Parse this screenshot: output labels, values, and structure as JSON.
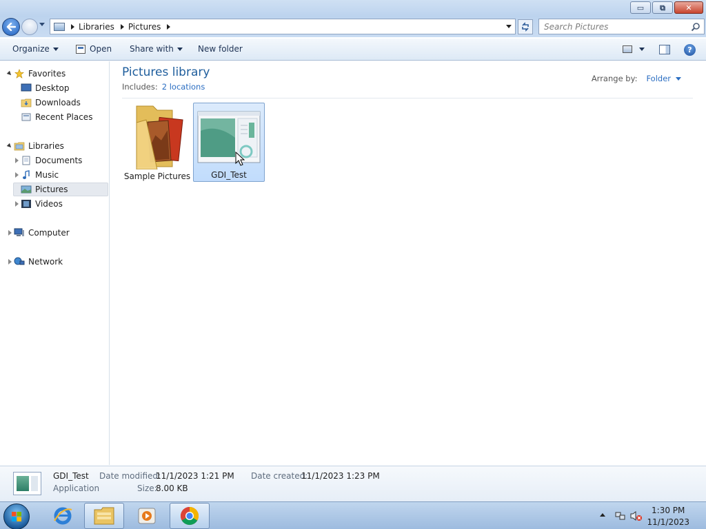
{
  "window": {
    "controls": {
      "minimize": "▭",
      "maximize": "⧉",
      "close": "✕"
    }
  },
  "address": {
    "crumbs": [
      "Libraries",
      "Pictures"
    ],
    "search_placeholder": "Search Pictures"
  },
  "toolbar": {
    "organize": "Organize",
    "open": "Open",
    "share_with": "Share with",
    "new_folder": "New folder"
  },
  "nav": {
    "favorites": {
      "label": "Favorites",
      "items": [
        "Desktop",
        "Downloads",
        "Recent Places"
      ]
    },
    "libraries": {
      "label": "Libraries",
      "items": [
        "Documents",
        "Music",
        "Pictures",
        "Videos"
      ],
      "selected": "Pictures"
    },
    "computer": "Computer",
    "network": "Network"
  },
  "content": {
    "title": "Pictures library",
    "includes_label": "Includes:",
    "includes_link": "2 locations",
    "arrange_label": "Arrange by:",
    "arrange_value": "Folder",
    "items": [
      {
        "name": "Sample Pictures",
        "type": "folder"
      },
      {
        "name": "GDI_Test",
        "type": "application",
        "selected": true
      }
    ]
  },
  "details": {
    "name": "GDI_Test",
    "type": "Application",
    "date_modified_label": "Date modified:",
    "date_modified": "11/1/2023 1:21 PM",
    "date_created_label": "Date created:",
    "date_created": "11/1/2023 1:23 PM",
    "size_label": "Size:",
    "size": "8.00 KB"
  },
  "taskbar": {
    "time": "1:30 PM",
    "date": "11/1/2023",
    "apps": [
      "internet-explorer",
      "windows-explorer",
      "media-player",
      "chrome"
    ]
  },
  "colors": {
    "accent_title": "#1e5d9c",
    "link": "#2b6ec2",
    "selection": "#c1dcfc"
  }
}
